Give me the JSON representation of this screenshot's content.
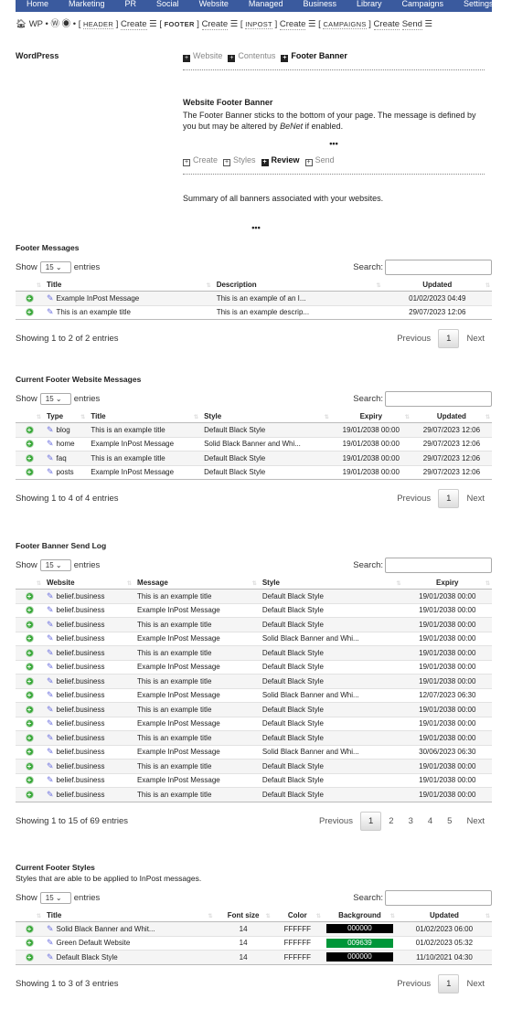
{
  "nav": [
    "Home",
    "Marketing",
    "PR",
    "Social",
    "Website",
    "Managed",
    "Business",
    "Library",
    "Campaigns",
    "Settings"
  ],
  "crumb": {
    "wp": "WP",
    "header": "HEADER",
    "footer": "FOOTER",
    "inpost": "INPOST",
    "campaigns": "CAMPAIGNS",
    "create": "Create",
    "send": "Send"
  },
  "left_label": "WordPress",
  "tabs1": [
    "Website",
    "Contentus",
    "Footer Banner"
  ],
  "intro": {
    "title": "Website Footer Banner",
    "text_a": "The Footer Banner sticks to the bottom of your page. The message is defined by you but may be altered by ",
    "text_em": "BeNet",
    "text_b": " if enabled."
  },
  "tabs2": [
    "Create",
    "Styles",
    "Review",
    "Send"
  ],
  "summary": "Summary of all banners associated with your websites.",
  "ellipsis": "•••",
  "labels": {
    "show": "Show",
    "entries": "entries",
    "search": "Search:",
    "page_size": "15",
    "previous": "Previous",
    "next": "Next"
  },
  "colors": {
    "nav": "#3a5a9e",
    "green_bg": "#009639",
    "black_bg": "#000000"
  },
  "tables": [
    {
      "title": "Footer Messages",
      "columns": [
        "Title",
        "Description",
        "Updated"
      ],
      "center": [
        2
      ],
      "rows": [
        [
          "Example InPost Message",
          "This is an example of an I...",
          "01/02/2023 04:49"
        ],
        [
          "This is an example title",
          "This is an example descrip...",
          "29/07/2023 12:06"
        ]
      ],
      "info": "Showing 1 to 2 of 2 entries",
      "pages": [
        "1"
      ]
    },
    {
      "title": "Current Footer Website Messages",
      "columns": [
        "Type",
        "Title",
        "Style",
        "Expiry",
        "Updated"
      ],
      "center": [
        3,
        4
      ],
      "rows": [
        [
          "blog",
          "This is an example title",
          "Default Black Style",
          "19/01/2038 00:00",
          "29/07/2023 12:06"
        ],
        [
          "home",
          "Example InPost Message",
          "Solid Black Banner and Whi...",
          "19/01/2038 00:00",
          "29/07/2023 12:06"
        ],
        [
          "faq",
          "This is an example title",
          "Default Black Style",
          "19/01/2038 00:00",
          "29/07/2023 12:06"
        ],
        [
          "posts",
          "Example InPost Message",
          "Default Black Style",
          "19/01/2038 00:00",
          "29/07/2023 12:06"
        ]
      ],
      "info": "Showing 1 to 4 of 4 entries",
      "pages": [
        "1"
      ]
    },
    {
      "title": "Footer Banner Send Log",
      "columns": [
        "Website",
        "Message",
        "Style",
        "Expiry"
      ],
      "center": [
        3
      ],
      "rows": [
        [
          "belief.business",
          "This is an example title",
          "Default Black Style",
          "19/01/2038 00:00"
        ],
        [
          "belief.business",
          "Example InPost Message",
          "Default Black Style",
          "19/01/2038 00:00"
        ],
        [
          "belief.business",
          "This is an example title",
          "Default Black Style",
          "19/01/2038 00:00"
        ],
        [
          "belief.business",
          "Example InPost Message",
          "Solid Black Banner and Whi...",
          "19/01/2038 00:00"
        ],
        [
          "belief.business",
          "This is an example title",
          "Default Black Style",
          "19/01/2038 00:00"
        ],
        [
          "belief.business",
          "Example InPost Message",
          "Default Black Style",
          "19/01/2038 00:00"
        ],
        [
          "belief.business",
          "This is an example title",
          "Default Black Style",
          "19/01/2038 00:00"
        ],
        [
          "belief.business",
          "Example InPost Message",
          "Solid Black Banner and Whi...",
          "12/07/2023 06:30"
        ],
        [
          "belief.business",
          "This is an example title",
          "Default Black Style",
          "19/01/2038 00:00"
        ],
        [
          "belief.business",
          "Example InPost Message",
          "Default Black Style",
          "19/01/2038 00:00"
        ],
        [
          "belief.business",
          "This is an example title",
          "Default Black Style",
          "19/01/2038 00:00"
        ],
        [
          "belief.business",
          "Example InPost Message",
          "Solid Black Banner and Whi...",
          "30/06/2023 06:30"
        ],
        [
          "belief.business",
          "This is an example title",
          "Default Black Style",
          "19/01/2038 00:00"
        ],
        [
          "belief.business",
          "Example InPost Message",
          "Default Black Style",
          "19/01/2038 00:00"
        ],
        [
          "belief.business",
          "This is an example title",
          "Default Black Style",
          "19/01/2038 00:00"
        ]
      ],
      "info": "Showing 1 to 15 of 69 entries",
      "pages": [
        "1",
        "2",
        "3",
        "4",
        "5"
      ]
    },
    {
      "title": "Current Footer Styles",
      "desc": "Styles that are able to be applied to InPost messages.",
      "columns": [
        "Title",
        "Font size",
        "Color",
        "Background",
        "Updated"
      ],
      "center": [
        1,
        2,
        3,
        4
      ],
      "rows": [
        [
          "Solid Black Banner and Whit...",
          "14",
          "FFFFFF",
          "000000",
          "01/02/2023 06:00"
        ],
        [
          "Green Default Website",
          "14",
          "FFFFFF",
          "009639",
          "01/02/2023 05:32"
        ],
        [
          "Default Black Style",
          "14",
          "FFFFFF",
          "000000",
          "11/10/2021 04:30"
        ]
      ],
      "info": "Showing 1 to 3 of 3 entries",
      "pages": [
        "1"
      ]
    }
  ]
}
